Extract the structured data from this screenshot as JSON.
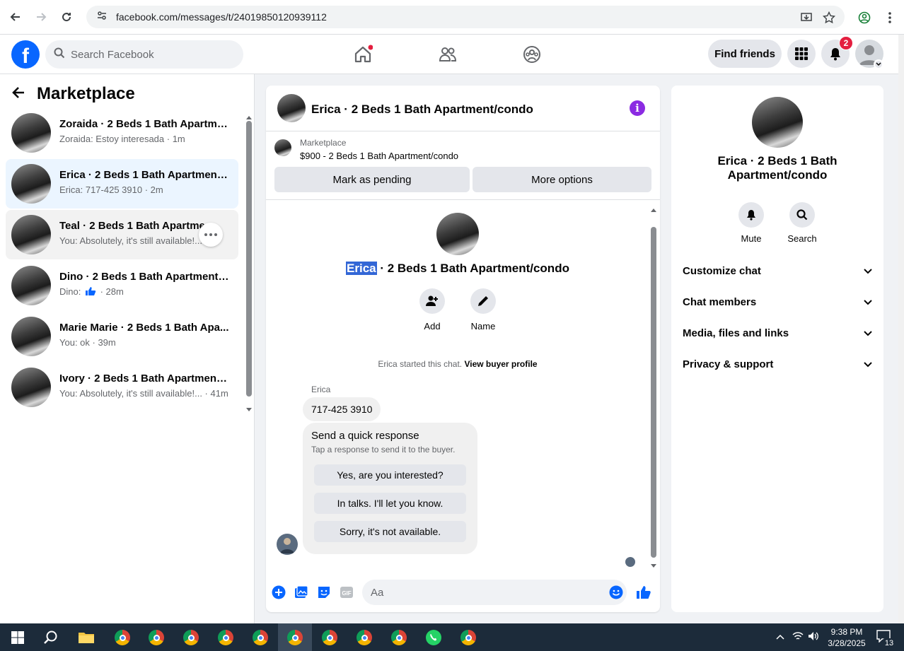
{
  "browser": {
    "url": "facebook.com/messages/t/24019850120939112"
  },
  "topbar": {
    "search_placeholder": "Search Facebook",
    "find_friends": "Find friends",
    "notification_count": "2"
  },
  "sidebar": {
    "title": "Marketplace",
    "conversations": [
      {
        "title": "Zoraida · 2 Beds 1 Bath Apartme...",
        "sub": "Zoraida: Estoy interesada · 1m"
      },
      {
        "title": "Erica · 2 Beds 1 Bath Apartment/...",
        "sub": "Erica: 717-425 3910 · 2m"
      },
      {
        "title": "Teal · 2 Beds 1 Bath Apartme...",
        "sub": "You: Absolutely, it's still available!... m"
      },
      {
        "title": "Dino · 2 Beds 1 Bath Apartment/...",
        "sub_prefix": "Dino:",
        "sub_suffix": "· 28m"
      },
      {
        "title": "Marie Marie · 2 Beds 1 Bath Apa...",
        "sub": "You: ok · 39m"
      },
      {
        "title": "Ivory · 2 Beds 1 Bath Apartment/...",
        "sub": "You: Absolutely, it's still available!... · 41m"
      }
    ]
  },
  "chat": {
    "header_name": "Erica · 2 Beds 1 Bath Apartment/condo",
    "marketplace_label": "Marketplace",
    "listing_price_title": "$900 - 2 Beds 1 Bath Apartment/condo",
    "mark_pending": "Mark as pending",
    "more_options": "More options",
    "center_name_highlight": "Erica",
    "center_name_rest": " · 2 Beds 1 Bath Apartment/condo",
    "add_label": "Add",
    "name_label": "Name",
    "started_text": "Erica started this chat.",
    "view_buyer": "View buyer profile",
    "sender": "Erica",
    "message": "717-425 3910",
    "quick_title": "Send a quick response",
    "quick_sub": "Tap a response to send it to the buyer.",
    "quick_responses": [
      "Yes, are you interested?",
      "In talks. I'll let you know.",
      "Sorry, it's not available."
    ],
    "composer_placeholder": "Aa"
  },
  "info": {
    "name": "Erica · 2 Beds 1 Bath Apartment/condo",
    "mute": "Mute",
    "search": "Search",
    "sections": [
      "Customize chat",
      "Chat members",
      "Media, files and links",
      "Privacy & support"
    ]
  },
  "taskbar": {
    "time": "9:38 PM",
    "date": "3/28/2025",
    "notif_count": "13"
  },
  "colors": {
    "fb_blue": "#0866ff",
    "info_purple": "#8b2be2",
    "active_conv": "#ebf5ff",
    "badge_red": "#e41e3f"
  }
}
